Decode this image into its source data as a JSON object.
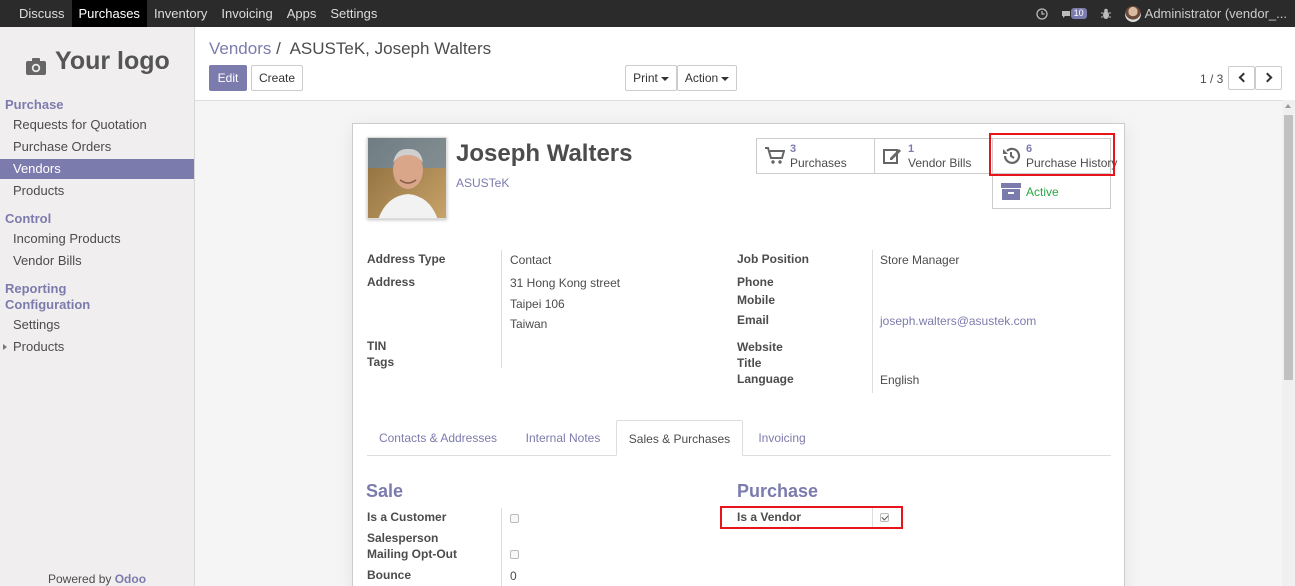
{
  "topbar": {
    "menu": [
      "Discuss",
      "Purchases",
      "Inventory",
      "Invoicing",
      "Apps",
      "Settings"
    ],
    "active_index": 1,
    "chat_count": "10",
    "user": "Administrator (vendor_..."
  },
  "sidebar": {
    "logo_text": "Your logo",
    "sections": [
      {
        "title": "Purchase",
        "items": [
          "Requests for Quotation",
          "Purchase Orders",
          "Vendors",
          "Products"
        ]
      },
      {
        "title": "Control",
        "items": [
          "Incoming Products",
          "Vendor Bills"
        ]
      },
      {
        "title": "Reporting",
        "items": []
      },
      {
        "title": "Configuration",
        "items": [
          "Settings",
          "Products"
        ]
      }
    ],
    "active_item": "Vendors",
    "powered_prefix": "Powered by",
    "powered_brand": "Odoo"
  },
  "control_panel": {
    "breadcrumb_parent": "Vendors",
    "breadcrumb_sep": "/",
    "breadcrumb_current": "ASUSTeK, Joseph Walters",
    "edit_label": "Edit",
    "create_label": "Create",
    "print_label": "Print",
    "action_label": "Action",
    "pager": "1 / 3"
  },
  "partner": {
    "name": "Joseph Walters",
    "company": "ASUSTeK"
  },
  "smart_buttons": {
    "purchases": {
      "count": "3",
      "label": "Purchases",
      "icon": "shopping-cart-icon"
    },
    "vendor_bills": {
      "count": "1",
      "label": "Vendor Bills",
      "icon": "edit-icon"
    },
    "purchase_history": {
      "count": "6",
      "label": "Purchase History",
      "icon": "history-icon"
    },
    "active": {
      "label": "Active",
      "icon": "archive-icon"
    }
  },
  "fields_left": {
    "address_type_label": "Address Type",
    "address_type": "Contact",
    "address_label": "Address",
    "street": "31 Hong Kong street",
    "city": "Taipei 106",
    "country": "Taiwan",
    "tin_label": "TIN",
    "tags_label": "Tags"
  },
  "fields_right": {
    "job_position_label": "Job Position",
    "job_position": "Store Manager",
    "phone_label": "Phone",
    "mobile_label": "Mobile",
    "email_label": "Email",
    "email": "joseph.walters@asustek.com",
    "website_label": "Website",
    "title_label": "Title",
    "language_label": "Language",
    "language": "English"
  },
  "tabs": [
    "Contacts & Addresses",
    "Internal Notes",
    "Sales & Purchases",
    "Invoicing"
  ],
  "active_tab": "Sales & Purchases",
  "sale": {
    "title": "Sale",
    "is_customer_label": "Is a Customer",
    "is_customer": false,
    "salesperson_label": "Salesperson",
    "mailing_optout_label": "Mailing Opt-Out",
    "mailing_optout": false,
    "bounce_label": "Bounce",
    "bounce": "0"
  },
  "purchase": {
    "title": "Purchase",
    "is_vendor_label": "Is a Vendor",
    "is_vendor": true
  },
  "colors": {
    "accent": "#7c7bad",
    "topbar": "#2b2b2b",
    "highlight": "#e8141b"
  }
}
